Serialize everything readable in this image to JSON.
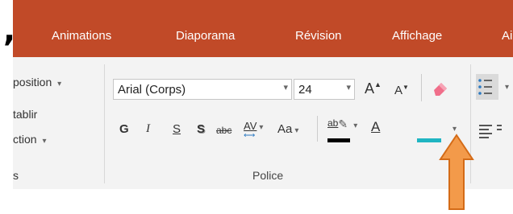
{
  "tabs": [
    "Animations",
    "Diaporama",
    "Révision",
    "Affichage",
    "Ai"
  ],
  "left_panel": {
    "items": [
      "position",
      "tablir",
      "ction"
    ],
    "group_label_fragment": "s"
  },
  "font_group": {
    "font_name": "Arial (Corps)",
    "font_size": "24",
    "grow_font": "A",
    "shrink_font": "A",
    "bold": "G",
    "italic": "I",
    "underline": "S",
    "shadow": "S",
    "strikethrough": "abc",
    "char_spacing": "AV",
    "change_case": "Aa",
    "highlight": "ab",
    "font_color": "A",
    "group_label": "Police"
  },
  "colors": {
    "ribbon_tab_bg": "#c14a28",
    "ribbon_bg": "#f3f3f3",
    "highlight_bar": "#000000",
    "font_color_bar": "#1fb5c2",
    "arrow_fill": "#f39a4a",
    "arrow_stroke": "#d46b17"
  },
  "icons": [
    "dropdown-caret",
    "grow-font-icon",
    "shrink-font-icon",
    "eraser-icon",
    "bullets-icon",
    "align-left-icon",
    "pointer-arrow"
  ]
}
